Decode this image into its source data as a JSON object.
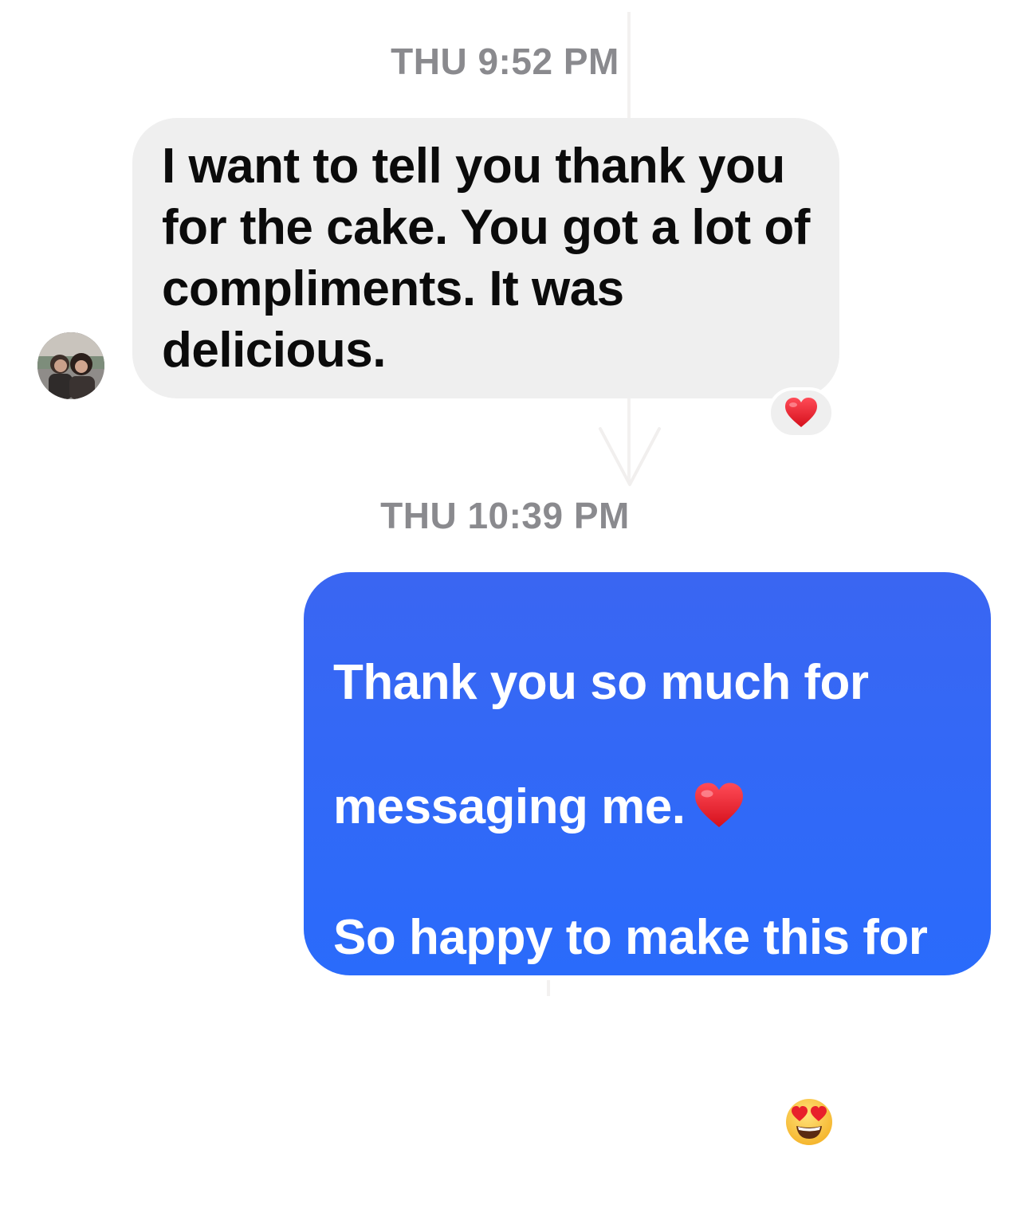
{
  "thread": {
    "timestamp_1": "THU 9:52 PM",
    "timestamp_2": "THU 10:39 PM"
  },
  "incoming_message": {
    "text": "I want to tell you thank you\nfor the cake. You got a lot of\ncompliments. It was\ndelicious.",
    "reaction": "heart-emoji",
    "bubble_color": "#efefef",
    "text_color": "#0b0b0b"
  },
  "outgoing_message": {
    "line_1": "Thank you so much for",
    "line_2": "messaging me.",
    "line_2_emoji": "heart-emoji",
    "line_3_to_6": "So happy to make this for\nyou. I told Joe i will have to\nadd this to my menu now.\nGreat combination.",
    "final_emoji": "heart-eyes-emoji",
    "bubble_color": "#2f69f6",
    "text_color": "#ffffff"
  },
  "colors": {
    "timestamp": "#8a8a8e",
    "background": "#ffffff"
  }
}
